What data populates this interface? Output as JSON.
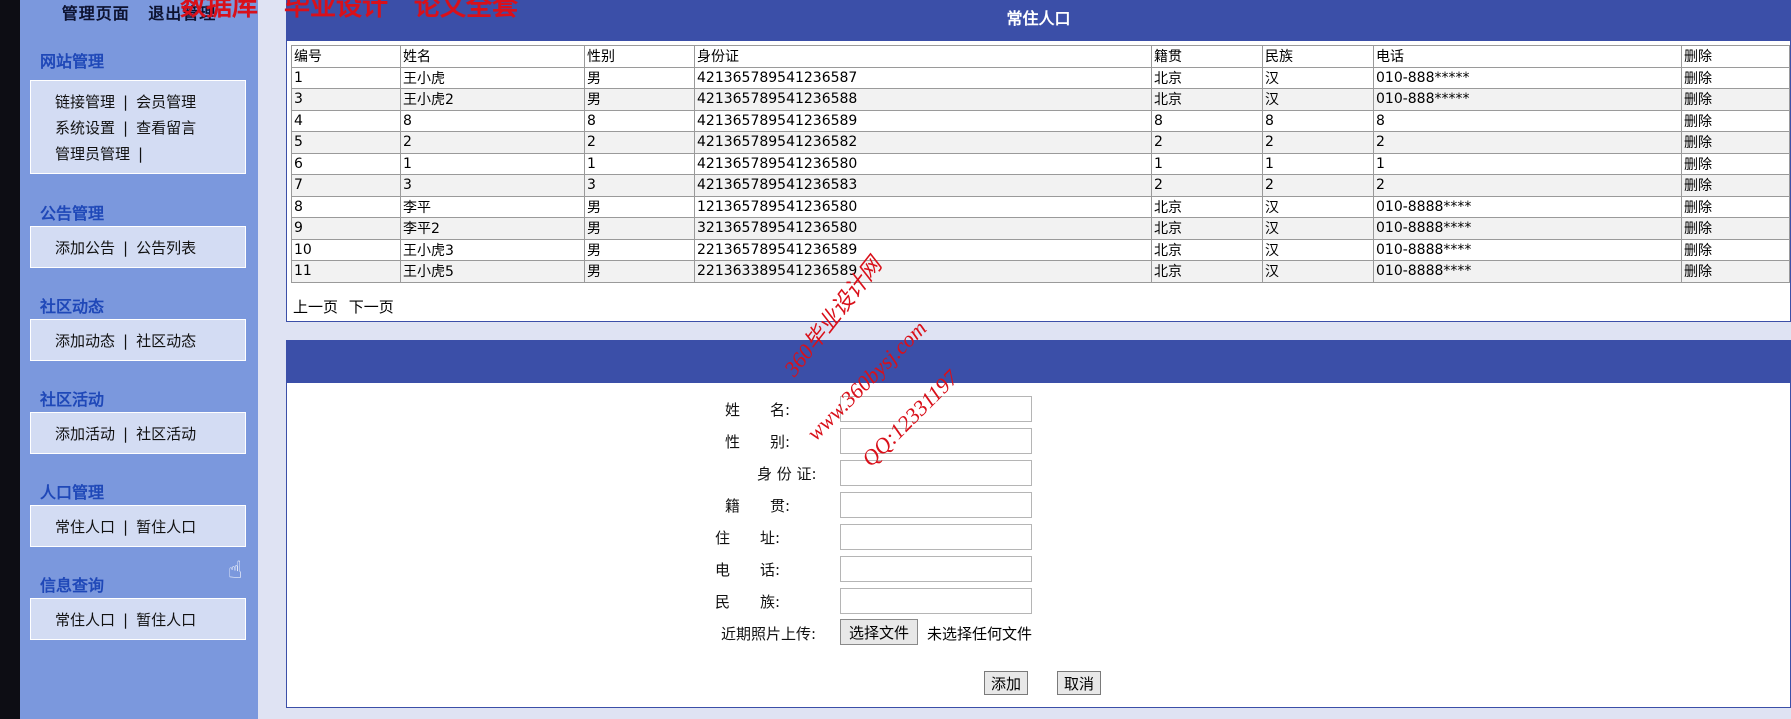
{
  "sidebar": {
    "top_links": [
      "管理页面",
      "退出管理"
    ],
    "sections": [
      {
        "title": "网站管理",
        "rows": [
          [
            "链接管理",
            "会员管理"
          ],
          [
            "系统设置",
            "查看留言"
          ],
          [
            "管理员管理",
            ""
          ]
        ]
      },
      {
        "title": "公告管理",
        "rows": [
          [
            "添加公告",
            "公告列表"
          ]
        ]
      },
      {
        "title": "社区动态",
        "rows": [
          [
            "添加动态",
            "社区动态"
          ]
        ]
      },
      {
        "title": "社区活动",
        "rows": [
          [
            "添加活动",
            "社区活动"
          ]
        ]
      },
      {
        "title": "人口管理",
        "rows": [
          [
            "常住人口",
            "暂住人口"
          ]
        ]
      },
      {
        "title": "信息查询",
        "rows": [
          [
            "常住人口",
            "暂住人口"
          ]
        ]
      }
    ]
  },
  "list_panel": {
    "title": "常住人口",
    "columns": [
      "编号",
      "姓名",
      "性别",
      "身份证",
      "籍贯",
      "民族",
      "电话",
      "删除"
    ],
    "rows": [
      [
        "1",
        "王小虎",
        "男",
        "421365789541236587",
        "北京",
        "汉",
        "010-888*****",
        "删除"
      ],
      [
        "3",
        "王小虎2",
        "男",
        "421365789541236588",
        "北京",
        "汉",
        "010-888*****",
        "删除"
      ],
      [
        "4",
        "8",
        "8",
        "421365789541236589",
        "8",
        "8",
        "8",
        "删除"
      ],
      [
        "5",
        "2",
        "2",
        "421365789541236582",
        "2",
        "2",
        "2",
        "删除"
      ],
      [
        "6",
        "1",
        "1",
        "421365789541236580",
        "1",
        "1",
        "1",
        "删除"
      ],
      [
        "7",
        "3",
        "3",
        "421365789541236583",
        "2",
        "2",
        "2",
        "删除"
      ],
      [
        "8",
        "李平",
        "男",
        "121365789541236580",
        "北京",
        "汉",
        "010-8888****",
        "删除"
      ],
      [
        "9",
        "李平2",
        "男",
        "321365789541236580",
        "北京",
        "汉",
        "010-8888****",
        "删除"
      ],
      [
        "10",
        "王小虎3",
        "男",
        "221365789541236589",
        "北京",
        "汉",
        "010-8888****",
        "删除"
      ],
      [
        "11",
        "王小虎5",
        "男",
        "221363389541236589",
        "北京",
        "汉",
        "010-8888****",
        "删除"
      ]
    ],
    "pager": {
      "prev": "上一页",
      "next": "下一页"
    }
  },
  "form": {
    "name_label": "姓　　名:",
    "gender_label": "性　　别:",
    "id_label": "身 份 证:",
    "native_label": "籍　　贯:",
    "address_label": "住　　址:",
    "phone_label": "电　　话:",
    "ethnic_label": "民　　族:",
    "photo_label": "近期照片上传:",
    "file_button": "选择文件",
    "file_status": "未选择任何文件",
    "submit": "添加",
    "cancel": "取消"
  },
  "watermark": {
    "line1": "360毕业设计网",
    "line2": "www.360bysj.com",
    "line3": "QQ:12331197",
    "top_text": "数据库　毕业设计　论文全套"
  },
  "colors": {
    "sidebar_bg": "#7b98dd",
    "header_bar": "#3b4fa8",
    "section_title": "#1f48b8",
    "watermark_red": "#d9101a"
  }
}
